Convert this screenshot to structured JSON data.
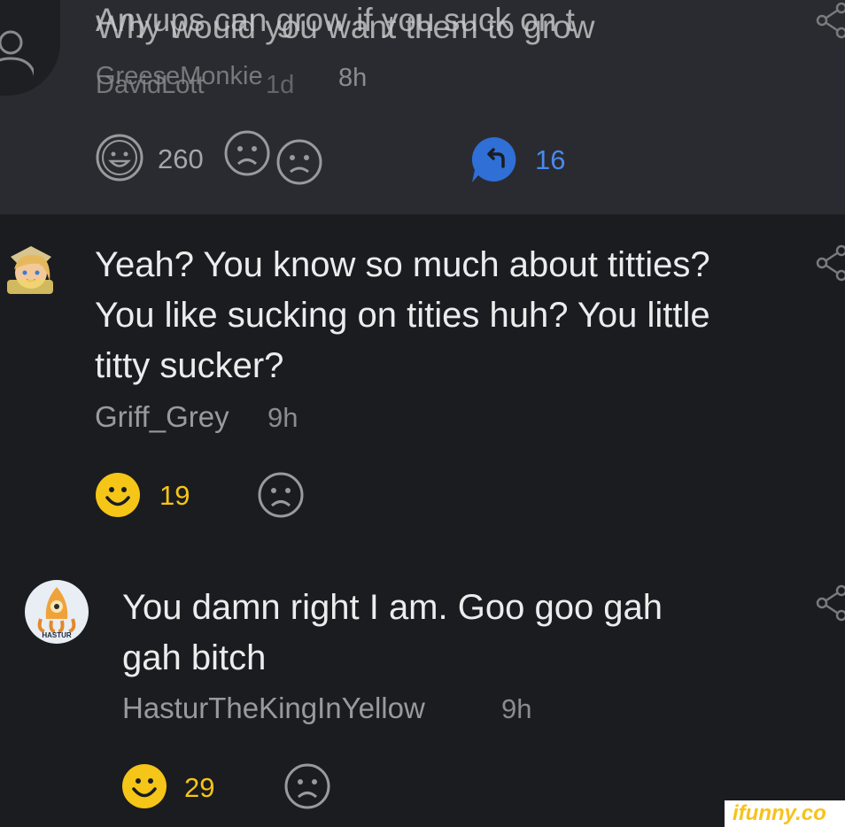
{
  "top_comment": {
    "text_a": "Anyups can grow if you suck on t",
    "text_b": "Why would you want them to grow",
    "author_a": "GreeseMonkie",
    "author_b": "DavidLott",
    "age_a": "8h",
    "age_b": "1d",
    "smile_count": "260",
    "reply_count": "16"
  },
  "comments": [
    {
      "text": "Yeah? You know so much about titties? You like sucking on tities huh? You little titty sucker?",
      "author": "Griff_Grey",
      "age": "9h",
      "smile_count": "19"
    },
    {
      "text": "You damn right I am. Goo goo gah gah bitch",
      "author": "HasturTheKingInYellow",
      "age": "9h",
      "smile_count": "29",
      "avatar_label": "HASTUR"
    }
  ],
  "watermark": "ifunny.co",
  "colors": {
    "smile": "#f5c518",
    "reply": "#2f6fd6",
    "bg": "#1b1c20",
    "top_bg": "#2a2b30"
  },
  "icons": [
    "user-icon",
    "smile-icon",
    "unsmile-icon",
    "reply-icon",
    "share-icon"
  ]
}
